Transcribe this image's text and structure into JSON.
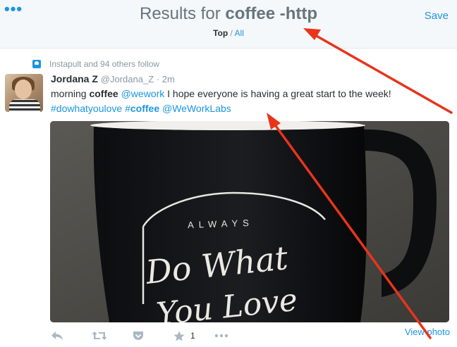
{
  "header": {
    "title_prefix": "Results for ",
    "query": "coffee -http",
    "save_label": "Save",
    "filter_top": "Top",
    "filter_sep": " / ",
    "filter_all": "All"
  },
  "tweet": {
    "context": "Instapult and 94 others follow",
    "name": "Jordana Z",
    "handle": "@Jordana_Z",
    "time": " · 2m",
    "text": {
      "t1": "morning ",
      "b1": "coffee",
      "t2": " ",
      "m1": "@wework",
      "t3": " I hope everyone is having a great start to the week!",
      "h1": "#dowhatyoulove",
      "t4": "  ",
      "h2_hash": "#",
      "h2_word": "coffee",
      "t5": " ",
      "m2": "@WeWorkLabs"
    },
    "photo_text": {
      "line1": "ALWAYS",
      "line2": "Do What",
      "line3": "You Love"
    },
    "favorite_count": "1",
    "view_photo": "View photo"
  },
  "colors": {
    "link": "#1b95e0",
    "annotation_arrow": "#e8341c"
  },
  "icons": [
    "more-icon",
    "follow-context-icon",
    "reply-icon",
    "retweet-icon",
    "pocket-icon",
    "favorite-icon",
    "more-actions-icon"
  ]
}
